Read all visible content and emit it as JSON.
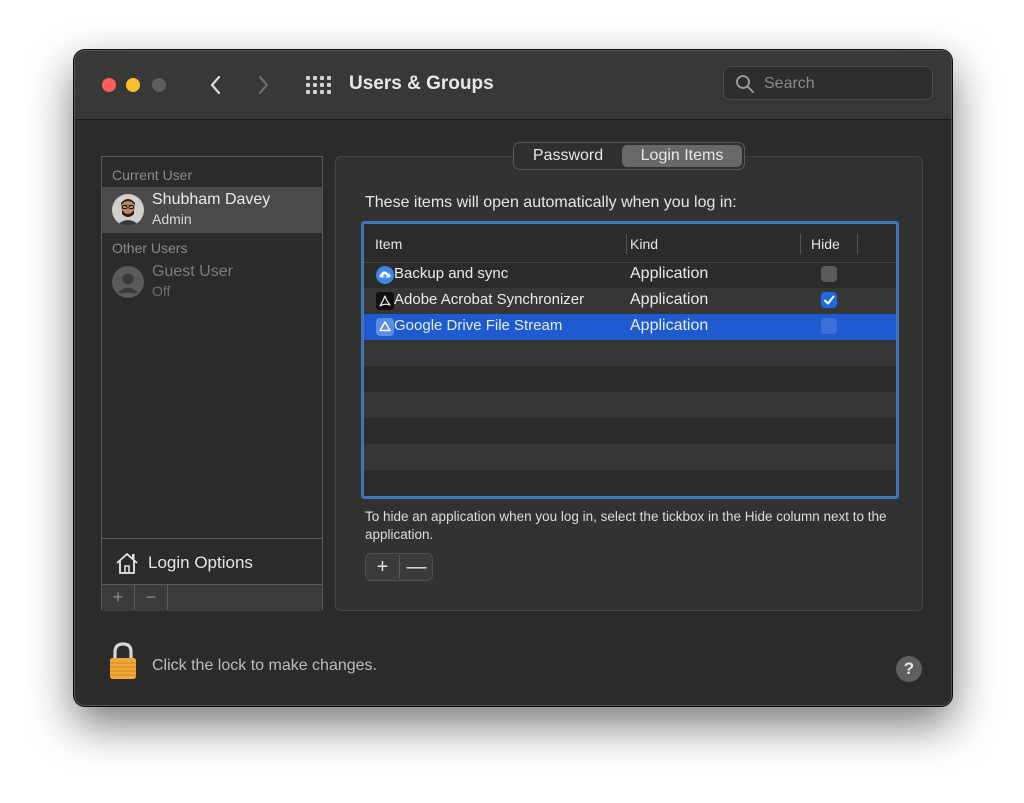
{
  "window": {
    "title": "Users & Groups"
  },
  "search": {
    "placeholder": "Search"
  },
  "users": {
    "current_label": "Current User",
    "current": {
      "name": "Shubham Davey",
      "role": "Admin"
    },
    "other_label": "Other Users",
    "guest": {
      "name": "Guest User",
      "role": "Off"
    },
    "login_options_label": "Login Options",
    "add_label": "+",
    "remove_label": "−"
  },
  "tabs": [
    {
      "label": "Password",
      "selected": false
    },
    {
      "label": "Login Items",
      "selected": true
    }
  ],
  "login_items": {
    "intro": "These items will open automatically when you log in:",
    "columns": {
      "item": "Item",
      "kind": "Kind",
      "hide": "Hide"
    },
    "rows": [
      {
        "item": "Backup and sync",
        "kind": "Application",
        "hide": false,
        "icon": "cloud-upload-icon"
      },
      {
        "item": "Adobe Acrobat Synchronizer",
        "kind": "Application",
        "hide": true,
        "icon": "acrobat-icon"
      },
      {
        "item": "Google Drive File Stream",
        "kind": "Application",
        "hide": false,
        "icon": "google-drive-icon",
        "selected": true
      }
    ],
    "hint": "To hide an application when you log in, select the tickbox in the Hide column next to the application.",
    "add_label": "+",
    "remove_label": "—"
  },
  "footer": {
    "lock_text": "Click the lock to make changes.",
    "help_label": "?"
  },
  "colors": {
    "selection": "#1f5bd0",
    "focus_ring": "#3e76b8",
    "checkbox_on": "#1e69e6"
  }
}
